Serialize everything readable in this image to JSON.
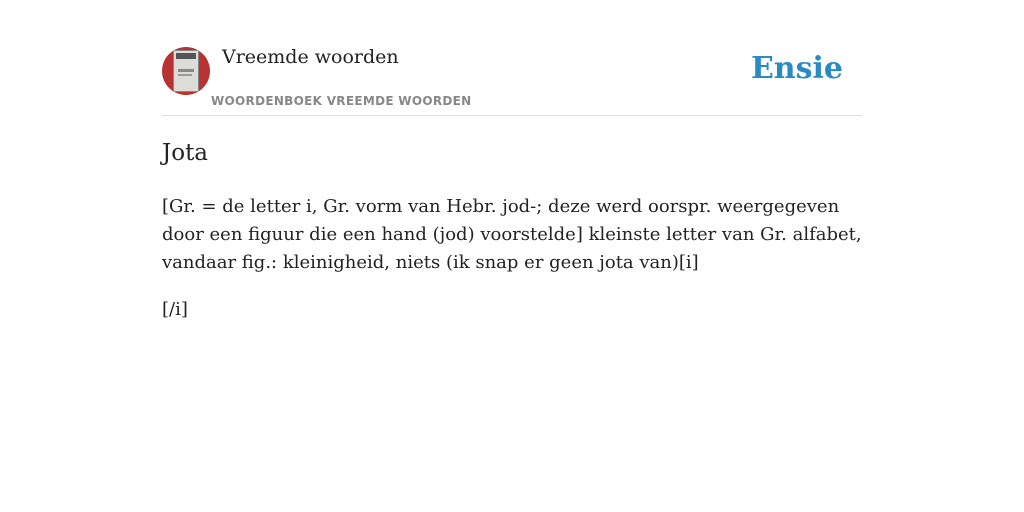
{
  "header": {
    "title": "Vreemde woorden",
    "subtitle": "WOORDENBOEK VREEMDE WOORDEN",
    "brand": "Ensie"
  },
  "entry": {
    "title": "Jota",
    "body": "[Gr. = de letter i, Gr. vorm van Hebr. jod-; deze werd oorspr. weergegeven door een figuur die een hand (jod) voorstelde] kleinste letter van Gr. alfabet, vandaar fig.: kleinigheid, niets (ik snap er geen jota van)[i]",
    "tail": "[/i]"
  },
  "colors": {
    "brand": "#2a8bc4",
    "avatar_bg": "#b83232",
    "subtitle": "#888888",
    "divider": "#dddddd"
  }
}
